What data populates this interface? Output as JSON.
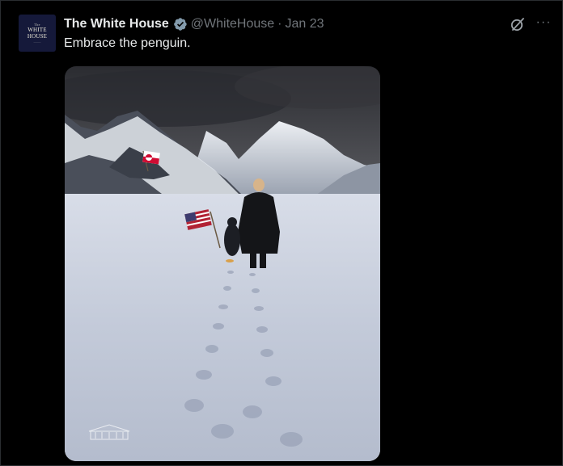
{
  "tweet": {
    "display_name": "The White House",
    "handle": "@WhiteHouse",
    "separator": "·",
    "date": "Jan 23",
    "text": "Embrace the penguin.",
    "verified_badge_color": "#829aab"
  },
  "avatar": {
    "line1": "The",
    "line2": "WHITE",
    "line3": "HOUSE",
    "background": "#15193a"
  },
  "actions": {
    "grok_icon": "grok-icon",
    "more_icon": "more-options-icon",
    "more_label": "···"
  },
  "media": {
    "image_icon": "mountain-snow-walk-image",
    "flags": [
      "greenland-flag",
      "us-flag"
    ]
  },
  "colors": {
    "background": "#000000",
    "text_primary": "#e7e9ea",
    "text_secondary": "#71767b"
  }
}
